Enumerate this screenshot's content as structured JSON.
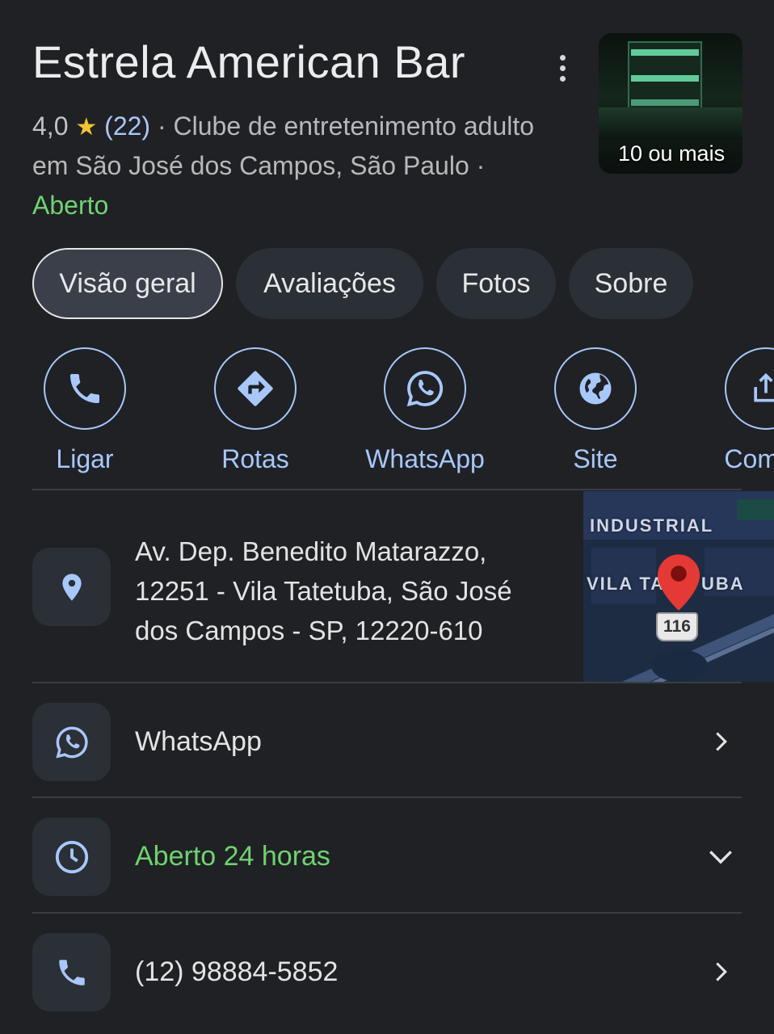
{
  "header": {
    "title": "Estrela American Bar",
    "rating": "4,0",
    "review_count": "(22)",
    "category_line1": "Clube de entretenimento adulto",
    "category_line2": "em São José dos Campos, São Paulo ·",
    "separator": "·",
    "status": "Aberto",
    "photo_label": "10 ou mais"
  },
  "tabs": [
    {
      "label": "Visão geral",
      "active": true
    },
    {
      "label": "Avaliações",
      "active": false
    },
    {
      "label": "Fotos",
      "active": false
    },
    {
      "label": "Sobre",
      "active": false
    }
  ],
  "actions": [
    {
      "label": "Ligar",
      "icon": "phone-icon"
    },
    {
      "label": "Rotas",
      "icon": "directions-icon"
    },
    {
      "label": "WhatsApp",
      "icon": "whatsapp-icon"
    },
    {
      "label": "Site",
      "icon": "globe-icon"
    },
    {
      "label": "Compa",
      "icon": "share-icon"
    }
  ],
  "address": {
    "line1": "Av. Dep. Benedito Matarazzo,",
    "line2": "12251 - Vila Tatetuba, São José",
    "line3": "dos Campos - SP, 12220-610",
    "icon": "location-pin-icon"
  },
  "map": {
    "label_industrial": "INDUSTRIAL",
    "label_vila_left": "VILA TA",
    "label_vila_right": "UBA",
    "route_number": "116"
  },
  "rows": {
    "whatsapp_label": "WhatsApp",
    "hours_label": "Aberto 24 horas",
    "phone_label": "(12) 98884-5852"
  },
  "colors": {
    "background": "#1f2125",
    "accent_blue": "#a8c7fa",
    "open_green": "#6fd36f",
    "star_yellow": "#f5c231",
    "pin_red": "#e53935"
  }
}
